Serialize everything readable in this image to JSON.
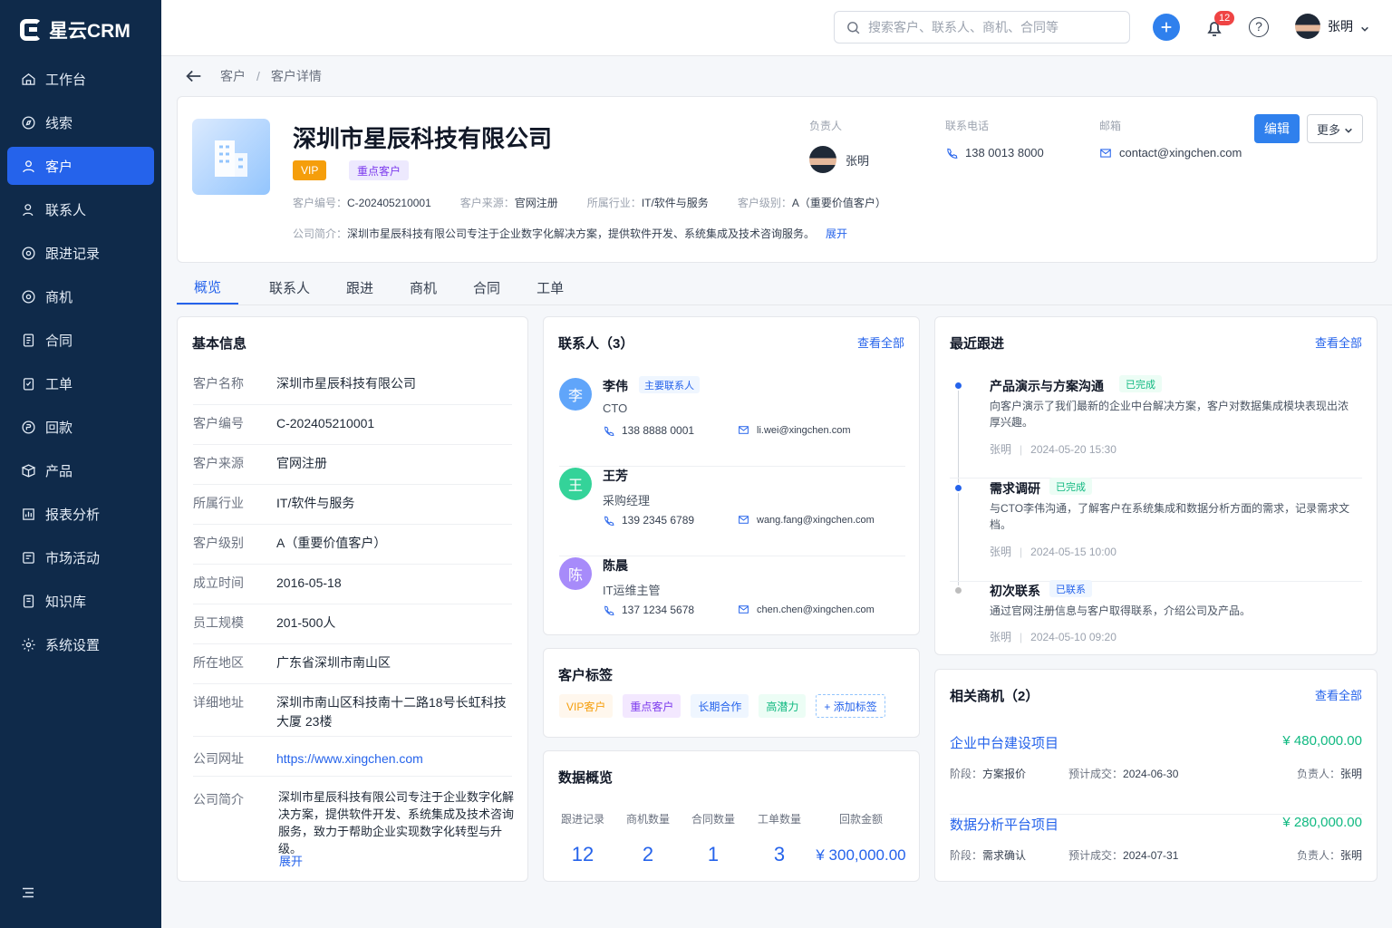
{
  "app": {
    "name": "星云CRM"
  },
  "sidebar": {
    "items": [
      {
        "label": "工作台",
        "icon": "home-icon"
      },
      {
        "label": "线索",
        "icon": "compass-icon"
      },
      {
        "label": "客户",
        "icon": "user-icon",
        "active": true
      },
      {
        "label": "联系人",
        "icon": "contact-icon"
      },
      {
        "label": "跟进记录",
        "icon": "clock-icon"
      },
      {
        "label": "商机",
        "icon": "target-icon"
      },
      {
        "label": "合同",
        "icon": "document-icon"
      },
      {
        "label": "工单",
        "icon": "checklist-icon"
      },
      {
        "label": "回款",
        "icon": "money-icon"
      },
      {
        "label": "产品",
        "icon": "package-icon"
      },
      {
        "label": "报表分析",
        "icon": "chart-icon"
      },
      {
        "label": "市场活动",
        "icon": "campaign-icon"
      },
      {
        "label": "知识库",
        "icon": "book-icon"
      },
      {
        "label": "系统设置",
        "icon": "gear-icon"
      }
    ]
  },
  "header": {
    "search_placeholder": "搜索客户、联系人、商机、合同等",
    "notification_count": "12",
    "user_name": "张明",
    "help_label": "?"
  },
  "breadcrumb": {
    "level1": "客户",
    "separator": "/",
    "level2": "客户详情"
  },
  "customer": {
    "name": "深圳市星辰科技有限公司",
    "tags": [
      "VIP",
      "重点客户"
    ],
    "number_label": "客户编号：",
    "number": "C-202405210001",
    "source_label": "客户来源：",
    "source": "官网注册",
    "industry_label": "所属行业：",
    "industry": "IT/软件与服务",
    "level_label": "客户级别：",
    "level": "A（重要价值客户）",
    "intro_label": "公司简介：",
    "intro": "深圳市星辰科技有限公司专注于企业数字化解决方案，提供软件开发、系统集成及技术咨询服务。",
    "expand": "展开",
    "owner_label": "负责人",
    "owner": "张明",
    "phone_label": "联系电话",
    "phone": "138 0013 8000",
    "email_label": "邮箱",
    "email": "contact@xingchen.com",
    "edit": "编辑",
    "more": "更多"
  },
  "tabs": [
    "概览",
    "联系人",
    "跟进",
    "商机",
    "合同",
    "工单"
  ],
  "basic": {
    "title": "基本信息",
    "fields": [
      {
        "k": "客户名称",
        "v": "深圳市星辰科技有限公司"
      },
      {
        "k": "客户编号",
        "v": "C-202405210001"
      },
      {
        "k": "客户来源",
        "v": "官网注册"
      },
      {
        "k": "所属行业",
        "v": "IT/软件与服务"
      },
      {
        "k": "客户级别",
        "v": "A（重要价值客户）"
      },
      {
        "k": "成立时间",
        "v": "2016-05-18"
      },
      {
        "k": "员工规模",
        "v": "201-500人"
      },
      {
        "k": "所在地区",
        "v": "广东省深圳市南山区"
      },
      {
        "k": "详细地址",
        "v": "深圳市南山区科技南十二路18号长虹科技大厦 23楼"
      },
      {
        "k": "公司网址",
        "v": "https://www.xingchen.com"
      },
      {
        "k": "公司简介",
        "v": "深圳市星辰科技有限公司专注于企业数字化解决方案，提供软件开发、系统集成及技术咨询服务，致力于帮助企业实现数字化转型与升级。"
      }
    ],
    "expand": "展开"
  },
  "contacts": {
    "title": "联系人（3）",
    "view_all": "查看全部",
    "items": [
      {
        "initial": "李",
        "name": "李伟",
        "tag": "主要联系人",
        "role": "CTO",
        "phone": "138 8888 0001",
        "email": "li.wei@xingchen.com",
        "color": "#60a5fa"
      },
      {
        "initial": "王",
        "name": "王芳",
        "role": "采购经理",
        "phone": "139 2345 6789",
        "email": "wang.fang@xingchen.com",
        "color": "#34d399"
      },
      {
        "initial": "陈",
        "name": "陈晨",
        "role": "IT运维主管",
        "phone": "137 1234 5678",
        "email": "chen.chen@xingchen.com",
        "color": "#a78bfa"
      }
    ]
  },
  "customer_tags": {
    "title": "客户标签",
    "items": [
      "VIP客户",
      "重点客户",
      "长期合作",
      "高潜力"
    ],
    "add": "+ 添加标签"
  },
  "stats": {
    "title": "数据概览",
    "items": [
      {
        "label": "跟进记录",
        "value": "12"
      },
      {
        "label": "商机数量",
        "value": "2"
      },
      {
        "label": "合同数量",
        "value": "1"
      },
      {
        "label": "工单数量",
        "value": "3"
      },
      {
        "label": "回款金额",
        "value": "¥ 300,000.00"
      }
    ]
  },
  "followups": {
    "title": "最近跟进",
    "view_all": "查看全部",
    "items": [
      {
        "title": "产品演示与方案沟通",
        "status": "已完成",
        "desc": "向客户演示了我们最新的企业中台解决方案，客户对数据集成模块表现出浓厚兴趣。",
        "user": "张明",
        "time": "2024-05-20 15:30"
      },
      {
        "title": "需求调研",
        "status": "已完成",
        "desc": "与CTO李伟沟通，了解客户在系统集成和数据分析方面的需求，记录需求文档。",
        "user": "张明",
        "time": "2024-05-15 10:00"
      },
      {
        "title": "初次联系",
        "status": "已联系",
        "desc": "通过官网注册信息与客户取得联系，介绍公司及产品。",
        "user": "张明",
        "time": "2024-05-10 09:20"
      }
    ]
  },
  "opportunities": {
    "title": "相关商机（2）",
    "view_all": "查看全部",
    "items": [
      {
        "title": "企业中台建设项目",
        "amount": "¥ 480,000.00",
        "stage_label": "阶段：",
        "stage": "方案报价",
        "date_label": "预计成交：",
        "date": "2024-06-30",
        "owner_label": "负责人：",
        "owner": "张明"
      },
      {
        "title": "数据分析平台项目",
        "amount": "¥ 280,000.00",
        "stage_label": "阶段：",
        "stage": "需求确认",
        "date_label": "预计成交：",
        "date": "2024-07-31",
        "owner_label": "负责人：",
        "owner": "张明"
      }
    ]
  },
  "colors": {
    "sidebar": "#0f2a4a",
    "accent": "#2563eb",
    "success": "#10b981",
    "warning": "#f59e0b"
  }
}
